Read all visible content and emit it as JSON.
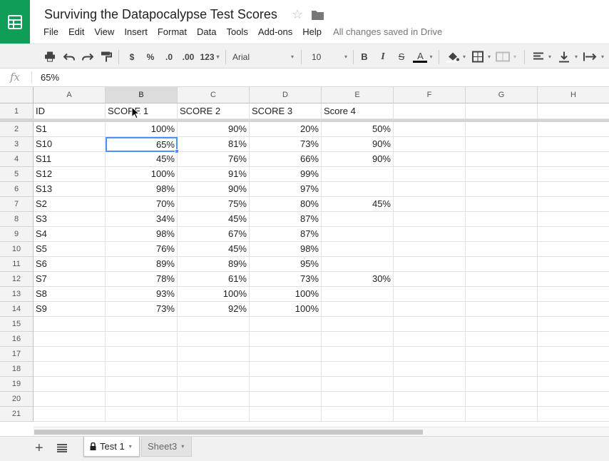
{
  "app": {
    "title": "Surviving the Datapocalypse Test Scores",
    "brand_color": "#0f9d58",
    "accent_color": "#4d90fe",
    "icons": [
      "sheets-logo-icon",
      "star-icon",
      "folder-icon"
    ]
  },
  "menu": {
    "items": [
      "File",
      "Edit",
      "View",
      "Insert",
      "Format",
      "Data",
      "Tools",
      "Add-ons",
      "Help"
    ],
    "status": "All changes saved in Drive"
  },
  "toolbar": {
    "currency": "$",
    "percent": "%",
    "decrease_decimals": ".0",
    "increase_decimals": ".00",
    "more_formats": "123",
    "font": "Arial",
    "font_size": "10",
    "bold": "B",
    "italic": "I",
    "strikethrough": "S",
    "text_color": "A"
  },
  "formula_bar": {
    "label": "fx",
    "value": "65%"
  },
  "grid": {
    "columns": [
      "A",
      "B",
      "C",
      "D",
      "E",
      "F",
      "G",
      "H"
    ],
    "selected_column": "B",
    "active_cell": "B3",
    "row_numbers": [
      "1",
      "2",
      "3",
      "4",
      "5",
      "6",
      "7",
      "8",
      "9",
      "10",
      "11",
      "12",
      "13",
      "14",
      "15",
      "16",
      "17",
      "18",
      "19",
      "20",
      "21"
    ],
    "header_row": [
      "ID",
      "SCORE 1",
      "SCORE 2",
      "SCORE 3",
      "Score 4"
    ],
    "rows": [
      [
        "S1",
        "100%",
        "90%",
        "20%",
        "50%"
      ],
      [
        "S10",
        "65%",
        "81%",
        "73%",
        "90%"
      ],
      [
        "S11",
        "45%",
        "76%",
        "66%",
        "90%"
      ],
      [
        "S12",
        "100%",
        "91%",
        "99%",
        ""
      ],
      [
        "S13",
        "98%",
        "90%",
        "97%",
        ""
      ],
      [
        "S2",
        "70%",
        "75%",
        "80%",
        "45%"
      ],
      [
        "S3",
        "34%",
        "45%",
        "87%",
        ""
      ],
      [
        "S4",
        "98%",
        "67%",
        "87%",
        ""
      ],
      [
        "S5",
        "76%",
        "45%",
        "98%",
        ""
      ],
      [
        "S6",
        "89%",
        "89%",
        "95%",
        ""
      ],
      [
        "S7",
        "78%",
        "61%",
        "73%",
        "30%"
      ],
      [
        "S8",
        "93%",
        "100%",
        "100%",
        ""
      ],
      [
        "S9",
        "73%",
        "92%",
        "100%",
        ""
      ]
    ]
  },
  "sheets": {
    "tabs": [
      "Test 1",
      "Sheet3"
    ],
    "active": "Test 1"
  }
}
